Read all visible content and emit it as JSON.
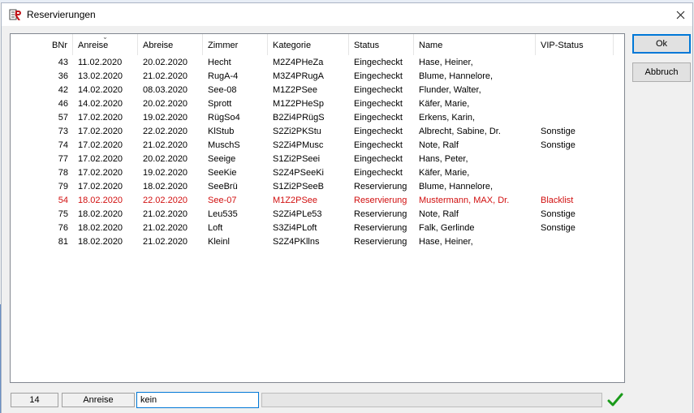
{
  "window": {
    "title": "Reservierungen"
  },
  "columns": [
    {
      "key": "bnr",
      "label": "BNr"
    },
    {
      "key": "anreise",
      "label": "Anreise"
    },
    {
      "key": "abreise",
      "label": "Abreise"
    },
    {
      "key": "zimmer",
      "label": "Zimmer"
    },
    {
      "key": "kategorie",
      "label": "Kategorie"
    },
    {
      "key": "status",
      "label": "Status"
    },
    {
      "key": "name",
      "label": "Name"
    },
    {
      "key": "vip",
      "label": "VIP-Status"
    }
  ],
  "sort_column": "anreise",
  "rows": [
    {
      "bnr": "43",
      "anreise": "11.02.2020",
      "abreise": "20.02.2020",
      "zimmer": "Hecht",
      "kategorie": "M2Z4PHeZa",
      "status": "Eingecheckt",
      "name": "Hase, Heiner,",
      "vip": "",
      "highlight": false
    },
    {
      "bnr": "36",
      "anreise": "13.02.2020",
      "abreise": "21.02.2020",
      "zimmer": "RugA-4",
      "kategorie": "M3Z4PRugA",
      "status": "Eingecheckt",
      "name": "Blume, Hannelore,",
      "vip": "",
      "highlight": false
    },
    {
      "bnr": "42",
      "anreise": "14.02.2020",
      "abreise": "08.03.2020",
      "zimmer": "See-08",
      "kategorie": "M1Z2PSee",
      "status": "Eingecheckt",
      "name": "Flunder, Walter,",
      "vip": "",
      "highlight": false
    },
    {
      "bnr": "46",
      "anreise": "14.02.2020",
      "abreise": "20.02.2020",
      "zimmer": "Sprott",
      "kategorie": "M1Z2PHeSp",
      "status": "Eingecheckt",
      "name": "Käfer, Marie,",
      "vip": "",
      "highlight": false
    },
    {
      "bnr": "57",
      "anreise": "17.02.2020",
      "abreise": "19.02.2020",
      "zimmer": "RügSo4",
      "kategorie": "B2Zi4PRügS",
      "status": "Eingecheckt",
      "name": "Erkens, Karin,",
      "vip": "",
      "highlight": false
    },
    {
      "bnr": "73",
      "anreise": "17.02.2020",
      "abreise": "22.02.2020",
      "zimmer": "KlStub",
      "kategorie": "S2Zi2PKStu",
      "status": "Eingecheckt",
      "name": "Albrecht, Sabine, Dr.",
      "vip": "Sonstige",
      "highlight": false
    },
    {
      "bnr": "74",
      "anreise": "17.02.2020",
      "abreise": "21.02.2020",
      "zimmer": "MuschS",
      "kategorie": "S2Zi4PMusc",
      "status": "Eingecheckt",
      "name": "Note, Ralf",
      "vip": "Sonstige",
      "highlight": false
    },
    {
      "bnr": "77",
      "anreise": "17.02.2020",
      "abreise": "20.02.2020",
      "zimmer": "Seeige",
      "kategorie": "S1Zi2PSeei",
      "status": "Eingecheckt",
      "name": "Hans, Peter,",
      "vip": "",
      "highlight": false
    },
    {
      "bnr": "78",
      "anreise": "17.02.2020",
      "abreise": "19.02.2020",
      "zimmer": "SeeKie",
      "kategorie": "S2Z4PSeeKi",
      "status": "Eingecheckt",
      "name": "Käfer, Marie,",
      "vip": "",
      "highlight": false
    },
    {
      "bnr": "79",
      "anreise": "17.02.2020",
      "abreise": "18.02.2020",
      "zimmer": "SeeBrü",
      "kategorie": "S1Zi2PSeeB",
      "status": "Reservierung",
      "name": "Blume, Hannelore,",
      "vip": "",
      "highlight": false
    },
    {
      "bnr": "54",
      "anreise": "18.02.2020",
      "abreise": "22.02.2020",
      "zimmer": "See-07",
      "kategorie": "M1Z2PSee",
      "status": "Reservierung",
      "name": "Mustermann, MAX, Dr.",
      "vip": "Blacklist",
      "highlight": true
    },
    {
      "bnr": "75",
      "anreise": "18.02.2020",
      "abreise": "21.02.2020",
      "zimmer": "Leu535",
      "kategorie": "S2Zi4PLe53",
      "status": "Reservierung",
      "name": "Note, Ralf",
      "vip": "Sonstige",
      "highlight": false
    },
    {
      "bnr": "76",
      "anreise": "18.02.2020",
      "abreise": "21.02.2020",
      "zimmer": "Loft",
      "kategorie": "S3Zi4PLoft",
      "status": "Reservierung",
      "name": "Falk, Gerlinde",
      "vip": "Sonstige",
      "highlight": false
    },
    {
      "bnr": "81",
      "anreise": "18.02.2020",
      "abreise": "21.02.2020",
      "zimmer": "Kleinl",
      "kategorie": "S2Z4PKllns",
      "status": "Reservierung",
      "name": "Hase, Heiner,",
      "vip": "",
      "highlight": false
    }
  ],
  "buttons": {
    "ok": "Ok",
    "cancel": "Abbruch"
  },
  "statusbar": {
    "count": "14",
    "field": "Anreise",
    "filter_value": "kein"
  },
  "colors": {
    "highlight_row": "#d10f0f",
    "accent": "#0078d7",
    "confirm": "#1a9a1a"
  },
  "icons": {
    "app": "reservation-app-icon",
    "close": "close-icon",
    "sort": "sort-indicator-icon",
    "confirm": "checkmark-icon"
  }
}
